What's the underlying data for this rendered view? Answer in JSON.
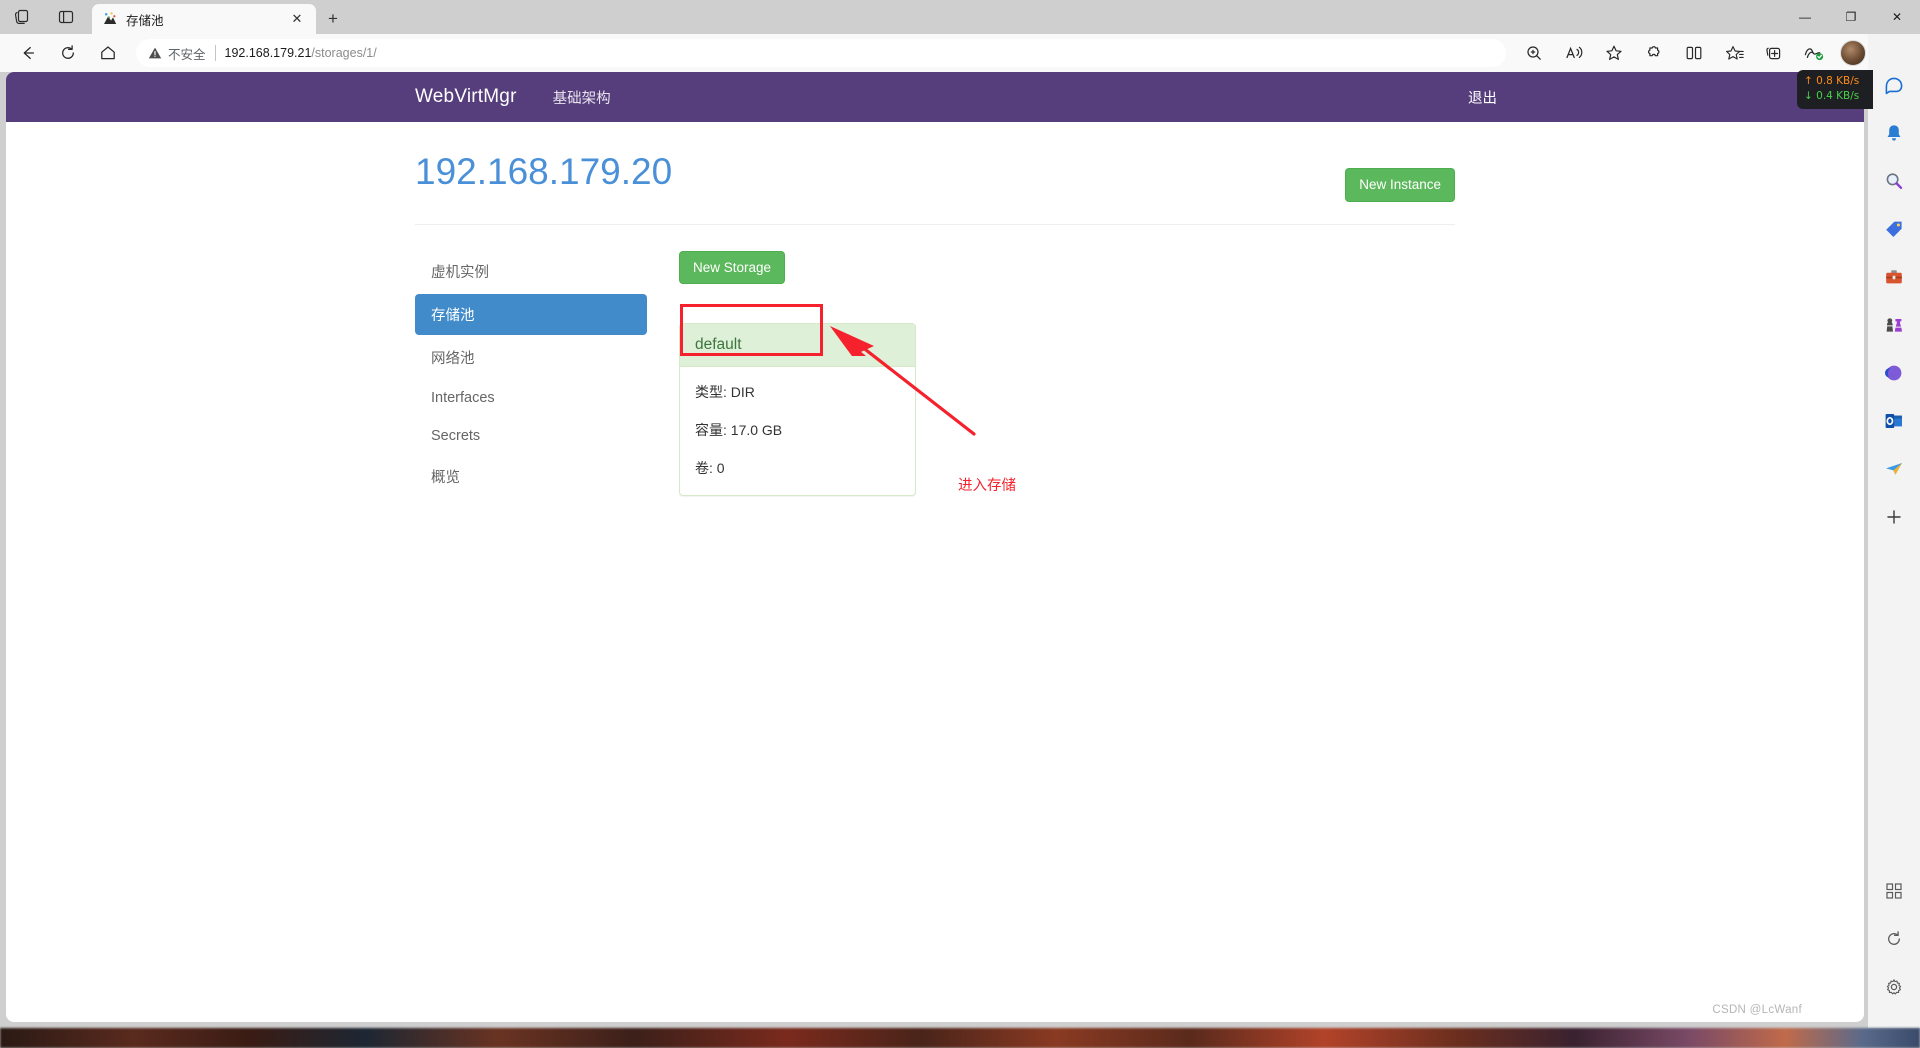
{
  "browser": {
    "tab": {
      "title": "存储池",
      "favicon_icon": "webvirtmgr-favicon",
      "close_icon": "close-icon"
    },
    "new_tab_label": "+",
    "window_controls": {
      "minimize": "—",
      "restore": "❐",
      "close": "✕"
    },
    "toolbar": {
      "back_icon": "back-arrow-icon",
      "refresh_icon": "refresh-icon",
      "home_icon": "home-icon",
      "security_label": "不安全",
      "url_host": "192.168.179.21",
      "url_path": "/storages/1/",
      "zoom_icon": "zoom-in-icon",
      "read_aloud_icon": "read-aloud-icon",
      "favorite_icon": "star-icon",
      "extensions_icon": "extensions-puzzle-icon",
      "split_screen_icon": "split-screen-icon",
      "collections_icon": "collections-star-icon",
      "add_tab_icon": "add-to-tabs-icon",
      "browser_essentials_icon": "browser-essentials-icon",
      "profile_icon": "avatar",
      "copilot_icon": "copilot-icon",
      "settings_icon": "more-settings-icon"
    },
    "rail": [
      {
        "name": "copilot-icon",
        "glyph": "✦"
      },
      {
        "name": "notifications-bell-icon",
        "glyph": "🔔"
      },
      {
        "name": "search-icon",
        "glyph": "🔍"
      },
      {
        "name": "shopping-tag-icon",
        "glyph": "🏷"
      },
      {
        "name": "tools-briefcase-icon",
        "glyph": "🧰"
      },
      {
        "name": "games-icon",
        "glyph": "♟"
      },
      {
        "name": "microsoft-365-icon",
        "glyph": "✺"
      },
      {
        "name": "outlook-icon",
        "glyph": "📧"
      },
      {
        "name": "send-icon",
        "glyph": "📨"
      },
      {
        "name": "add-sidebar-icon",
        "glyph": "＋"
      }
    ],
    "rail_bottom": [
      {
        "name": "customize-sidebar-icon",
        "glyph": "⛶"
      },
      {
        "name": "sidebar-refresh-icon",
        "glyph": "⟳"
      },
      {
        "name": "sidebar-settings-icon",
        "glyph": "⚙"
      }
    ]
  },
  "net_speed": {
    "upload": "↑ 0.8 KB/s",
    "download": "↓ 0.4 KB/s",
    "upload_color": "#ff8c19",
    "download_color": "#49d049"
  },
  "app": {
    "brand": "WebVirtMgr",
    "nav_link": "基础架构",
    "logout": "退出",
    "navbar_color": "#563d7c"
  },
  "page": {
    "title": "192.168.179.20",
    "title_color": "#4a90d9",
    "new_instance_button": "New Instance",
    "new_storage_button": "New Storage"
  },
  "sidebar": {
    "items": [
      {
        "label": "虚机实例",
        "active": false
      },
      {
        "label": "存储池",
        "active": true
      },
      {
        "label": "网络池",
        "active": false
      },
      {
        "label": "Interfaces",
        "active": false
      },
      {
        "label": "Secrets",
        "active": false
      },
      {
        "label": "概览",
        "active": false
      }
    ]
  },
  "storage_panel": {
    "name": "default",
    "rows": [
      {
        "label": "类型:",
        "value": "DIR"
      },
      {
        "label": "容量:",
        "value": "17.0 GB"
      },
      {
        "label": "卷:",
        "value": "0"
      }
    ]
  },
  "annotation": {
    "text": "进入存储",
    "color": "#f5222d"
  },
  "watermark": "CSDN @LcWanf"
}
